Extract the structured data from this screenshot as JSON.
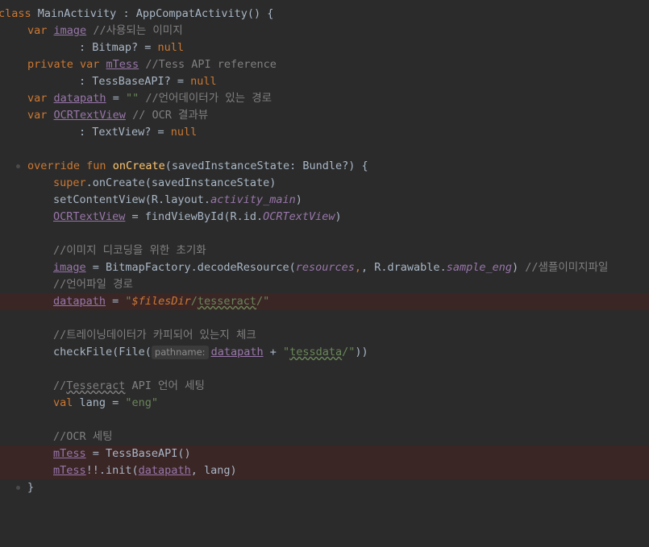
{
  "editor": {
    "lines": {
      "l1": {
        "kw": "class",
        "name": "MainActivity",
        "sep": " : ",
        "parent": "AppCompatActivity",
        "rest": "() {"
      },
      "l2": {
        "kw": "var",
        "field": "image",
        "comment": "//사용되는 이미지"
      },
      "l3": {
        "text": ": Bitmap? = ",
        "kw": "null"
      },
      "l4": {
        "kw": "private var",
        "field": "mTess",
        "comment": "//Tess API reference"
      },
      "l5": {
        "text": ": TessBaseAPI? = ",
        "kw": "null"
      },
      "l6": {
        "kw": "var",
        "field": "datapath",
        "eq": " = ",
        "str": "\"\"",
        "comment": "//언어데이터가 있는 경로"
      },
      "l7": {
        "kw": "var",
        "field": "OCRTextView",
        "comment": "// OCR 결과뷰"
      },
      "l8": {
        "text": ": TextView? = ",
        "kw": "null"
      },
      "l10": {
        "kw": "override fun",
        "fn": "onCreate",
        "rest": "(savedInstanceState: Bundle?) {"
      },
      "l11": {
        "kw": "super",
        "rest": ".onCreate(savedInstanceState)"
      },
      "l12": {
        "pre": "setContentView(R.layout.",
        "italic": "activity_main",
        "post": ")"
      },
      "l13": {
        "field": "OCRTextView",
        "mid": " = findViewById(R.id.",
        "italic": "OCRTextView",
        "post": ")"
      },
      "l15": {
        "comment": "//이미지 디코딩을 위한 초기화"
      },
      "l16": {
        "field": "image",
        "mid": " = BitmapFactory.decodeResource(",
        "italic1": "resources",
        "comma": ", R.drawable.",
        "italic2": "sample_eng",
        "post": ") ",
        "comment": "//샘플이미지파일"
      },
      "l17": {
        "comment": "//언어파일 경로"
      },
      "l18": {
        "field": "datapath",
        "eq": " = ",
        "q1": "\"",
        "tmpl": "$filesDir",
        "slash": "/",
        "strU": "tesseract",
        "q2": "/\""
      },
      "l20": {
        "comment": "//트레이닝데이터가 카피되어 있는지 체크"
      },
      "l21": {
        "pre": "checkFile(File(",
        "hint": "pathname:",
        "field": "datapath",
        "mid": " + ",
        "q1": "\"",
        "strU": "tessdata",
        "q2": "/\"",
        "post": "))"
      },
      "l23": {
        "c1": "//",
        "cU": "Tesseract",
        "c2": " API 언어 세팅"
      },
      "l24": {
        "kw": "val",
        "rest": " lang = ",
        "str": "\"eng\""
      },
      "l26": {
        "comment": "//OCR 세팅"
      },
      "l27": {
        "field": "mTess",
        "rest": " = TessBaseAPI()"
      },
      "l28": {
        "field": "mTess",
        "mid": "!!.init(",
        "field2": "datapath",
        "post": ", lang)"
      },
      "l29": {
        "text": "}"
      }
    }
  },
  "colors": {
    "background": "#2b2b2b",
    "keyword": "#cc7832",
    "field": "#9876aa",
    "function": "#ffc66d",
    "string": "#6a8759",
    "comment": "#808080",
    "text": "#a9b7c6",
    "highlight_line": "#3b2626"
  }
}
